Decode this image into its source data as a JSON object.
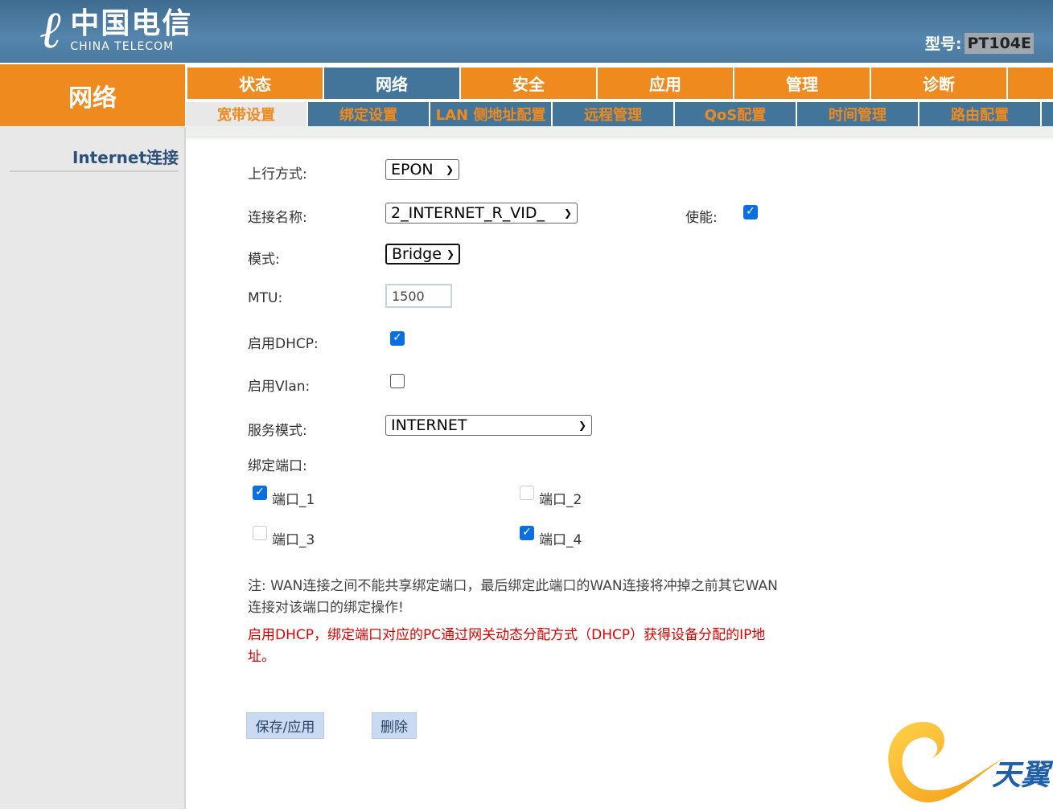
{
  "header": {
    "logo_cn": "中国电信",
    "logo_en": "CHINA TELECOM",
    "model_label": "型号:",
    "model_value": "PT104E"
  },
  "section_title": "网络",
  "tabs": [
    {
      "label": "状态"
    },
    {
      "label": "网络",
      "active": true
    },
    {
      "label": "安全"
    },
    {
      "label": "应用"
    },
    {
      "label": "管理"
    },
    {
      "label": "诊断"
    }
  ],
  "subtabs": [
    {
      "label": "宽带设置",
      "active": true
    },
    {
      "label": "绑定设置"
    },
    {
      "label": "LAN 侧地址配置"
    },
    {
      "label": "远程管理"
    },
    {
      "label": "QoS配置"
    },
    {
      "label": "时间管理"
    },
    {
      "label": "路由配置"
    }
  ],
  "sidebar": {
    "items": [
      {
        "label": "Internet连接"
      }
    ]
  },
  "form": {
    "uplink_label": "上行方式:",
    "uplink_value": "EPON",
    "conn_name_label": "连接名称:",
    "conn_name_value": "2_INTERNET_R_VID_",
    "enable_label": "使能:",
    "enable_checked": true,
    "mode_label": "模式:",
    "mode_value": "Bridge",
    "mtu_label": "MTU:",
    "mtu_value": "1500",
    "dhcp_label": "启用DHCP:",
    "dhcp_checked": true,
    "vlan_label": "启用Vlan:",
    "vlan_checked": false,
    "service_label": "服务模式:",
    "service_value": "INTERNET",
    "bind_label": "绑定端口:",
    "ports": [
      {
        "label": "端口_1",
        "checked": true
      },
      {
        "label": "端口_2",
        "checked": false
      },
      {
        "label": "端口_3",
        "checked": false
      },
      {
        "label": "端口_4",
        "checked": true
      }
    ]
  },
  "notes": {
    "note1": "注: WAN连接之间不能共享绑定端口，最后绑定此端口的WAN连接将冲掉之前其它WAN连接对该端口的绑定操作!",
    "note2": "启用DHCP，绑定端口对应的PC通过网关动态分配方式（DHCP）获得设备分配的IP地址。",
    "note2_color": "#e00000"
  },
  "buttons": {
    "save": "保存/应用",
    "delete": "删除"
  },
  "brand": {
    "tianyi": "天翼"
  },
  "colors": {
    "orange": "#ef8a1f",
    "blue": "#43759a"
  }
}
